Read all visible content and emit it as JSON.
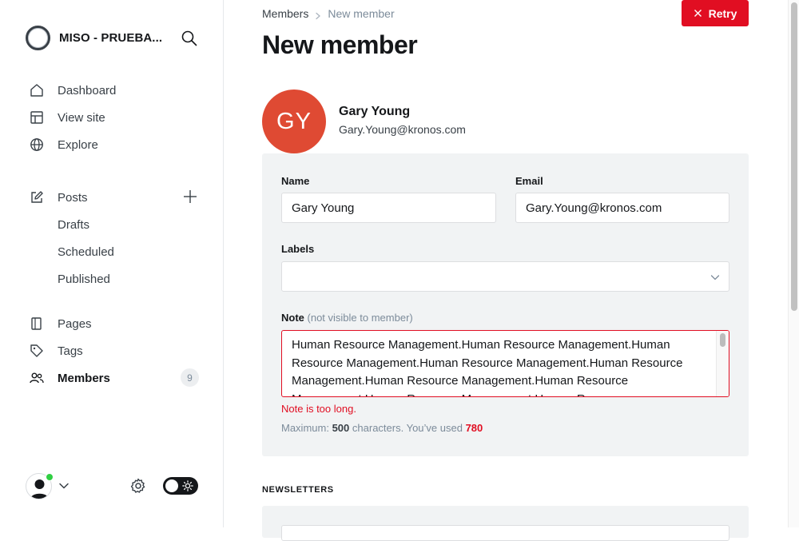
{
  "sidebar": {
    "site_name": "MISO - PRUEBA...",
    "nav": {
      "dashboard": "Dashboard",
      "view_site": "View site",
      "explore": "Explore",
      "posts": "Posts",
      "drafts": "Drafts",
      "scheduled": "Scheduled",
      "published": "Published",
      "pages": "Pages",
      "tags": "Tags",
      "members": "Members"
    },
    "members_count": "9",
    "user_online_color": "#30cf43"
  },
  "header": {
    "breadcrumb_parent": "Members",
    "breadcrumb_current": "New member",
    "retry_label": "Retry",
    "title": "New member"
  },
  "member": {
    "initials": "GY",
    "name": "Gary Young",
    "email": "Gary.Young@kronos.com",
    "avatar_color": "#df4a33"
  },
  "form": {
    "name_label": "Name",
    "name_value": "Gary Young",
    "email_label": "Email",
    "email_value": "Gary.Young@kronos.com",
    "labels_label": "Labels",
    "labels_value": "",
    "note_label": "Note",
    "note_hint": "(not visible to member)",
    "note_value": "Human Resource Management.Human Resource Management.Human Resource Management.Human Resource Management.Human Resource Management.Human Resource Management.Human Resource Management.Human Resource Management.Human Resource",
    "note_error": "Note is too long.",
    "note_count_prefix": "Maximum:",
    "note_max": "500",
    "note_count_mid": "characters. You’ve used",
    "note_used": "780"
  },
  "newsletters": {
    "heading": "NEWSLETTERS"
  },
  "colors": {
    "accent_red": "#e10e22",
    "panel_bg": "#f1f3f4"
  }
}
